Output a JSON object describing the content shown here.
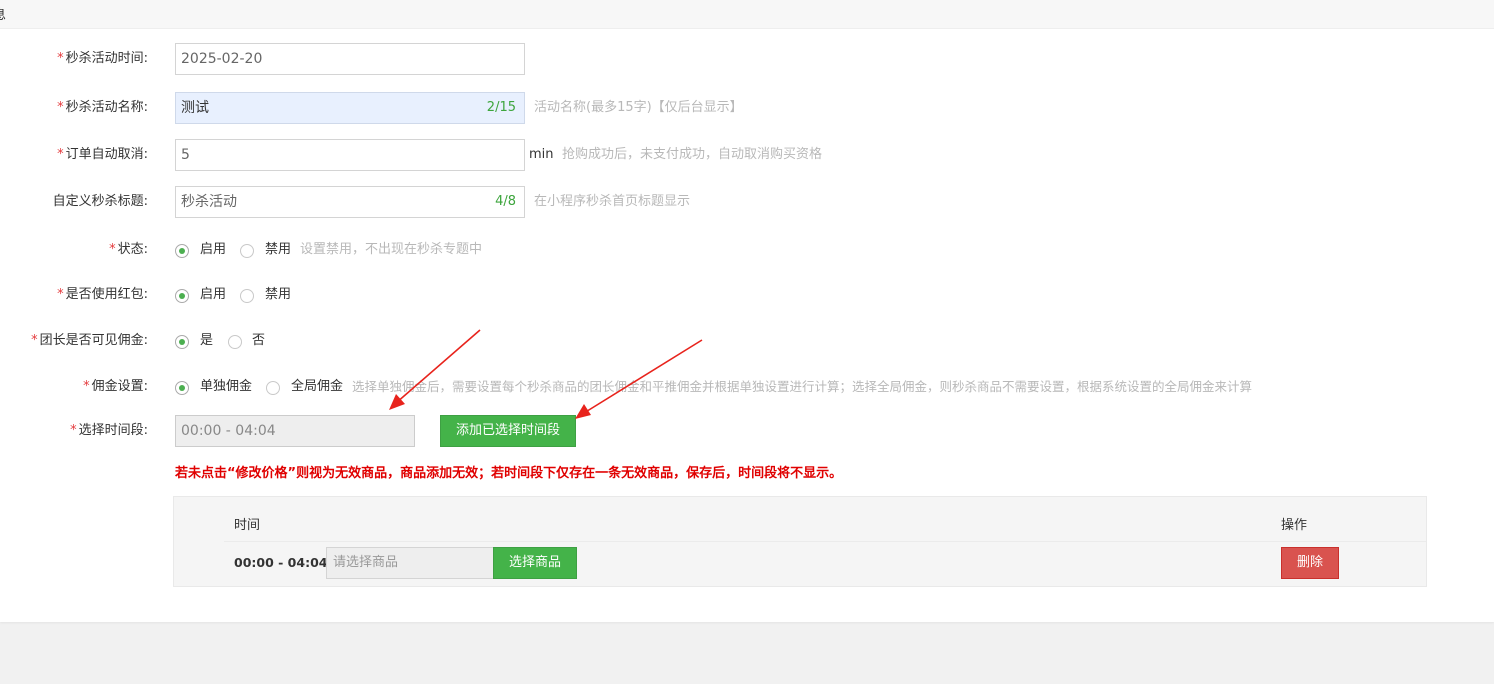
{
  "panel": {
    "title": "息"
  },
  "form": {
    "activity_time": {
      "label": "秒杀活动时间:",
      "value": "2025-02-20"
    },
    "activity_name": {
      "label": "秒杀活动名称:",
      "value": "测试",
      "counter": "2/15",
      "hint": "活动名称(最多15字)【仅后台显示】"
    },
    "auto_cancel": {
      "label": "订单自动取消:",
      "value": "5",
      "unit": "min",
      "hint": "抢购成功后，未支付成功，自动取消购买资格"
    },
    "custom_title": {
      "label": "自定义秒杀标题:",
      "value": "秒杀活动",
      "counter": "4/8",
      "hint": "在小程序秒杀首页标题显示"
    },
    "status": {
      "label": "状态:",
      "options": [
        "启用",
        "禁用"
      ],
      "selected": "启用",
      "hint": "设置禁用，不出现在秒杀专题中"
    },
    "use_redpacket": {
      "label": "是否使用红包:",
      "options": [
        "启用",
        "禁用"
      ],
      "selected": "启用"
    },
    "leader_commission_visible": {
      "label": "团长是否可见佣金:",
      "options": [
        "是",
        "否"
      ],
      "selected": "是"
    },
    "commission_setting": {
      "label": "佣金设置:",
      "options": [
        "单独佣金",
        "全局佣金"
      ],
      "selected": "单独佣金",
      "hint": "选择单独佣金后，需要设置每个秒杀商品的团长佣金和平推佣金并根据单独设置进行计算；选择全局佣金，则秒杀商品不需要设置，根据系统设置的全局佣金来计算"
    },
    "time_slot": {
      "label": "选择时间段:",
      "value": "00:00 - 04:04",
      "add_button": "添加已选择时间段"
    }
  },
  "warning": "若未点击“修改价格”则视为无效商品，商品添加无效；若时间段下仅存在一条无效商品，保存后，时间段将不显示。",
  "table": {
    "col_time": "时间",
    "col_action": "操作",
    "rows": [
      {
        "time": "00:00 - 04:04",
        "placeholder": "请选择商品",
        "select_button": "选择商品",
        "delete_button": "删除"
      }
    ]
  },
  "colors": {
    "accent_green": "#44b349",
    "danger_red": "#d9534f",
    "required_star": "#e4393c",
    "warning_text": "#e00000",
    "arrow": "#e8231c"
  }
}
